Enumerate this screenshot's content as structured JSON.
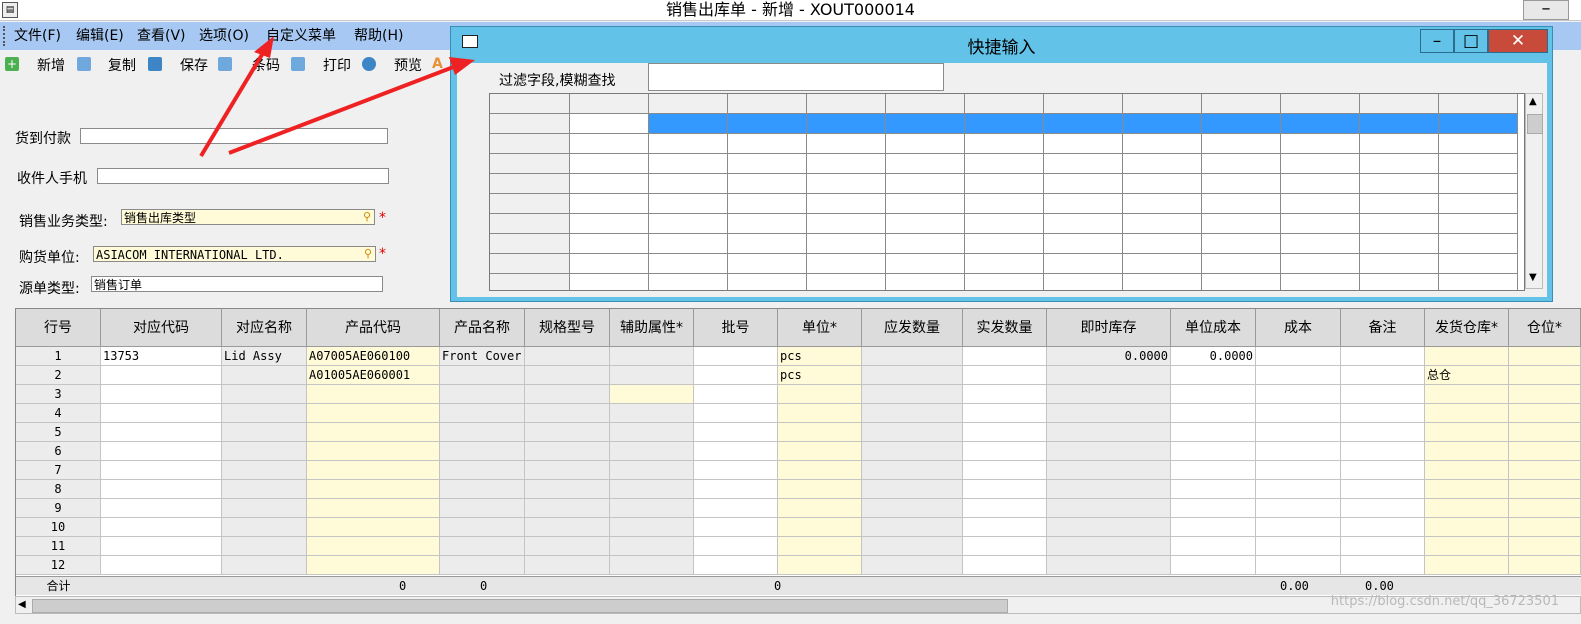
{
  "window": {
    "title": "销售出库单 - 新增 - XOUT000014"
  },
  "menu": {
    "items": [
      "文件(F)",
      "编辑(E)",
      "查看(V)",
      "选项(O)",
      "自定义菜单",
      "帮助(H)"
    ]
  },
  "toolbar": {
    "new": "新增",
    "copy": "复制",
    "save": "保存",
    "barcode": "条码",
    "print": "打印",
    "preview": "预览"
  },
  "form": {
    "cod_label": "货到付款",
    "phone_label": "收件人手机",
    "biztype_label": "销售业务类型:",
    "biztype_value": "销售出库类型",
    "buyer_label": "购货单位:",
    "buyer_value": "ASIACOM INTERNATIONAL LTD.",
    "srctype_label": "源单类型:",
    "srctype_value": "销售订单"
  },
  "popup": {
    "title": "快捷输入",
    "filter_label": "过滤字段,模糊查找",
    "filter_value": ""
  },
  "grid": {
    "headers": [
      "行号",
      "对应代码",
      "对应名称",
      "产品代码",
      "产品名称",
      "规格型号",
      "辅助属性*",
      "批号",
      "单位*",
      "应发数量",
      "实发数量",
      "即时库存",
      "单位成本",
      "成本",
      "备注",
      "发货仓库*",
      "仓位*"
    ],
    "rows": [
      {
        "no": "1",
        "code": "13753",
        "name": "Lid Assy",
        "product_code": "A07005AE060100",
        "product_name": "Front Cover",
        "unit": "pcs",
        "stock": "0.0000",
        "unit_cost": "0.0000",
        "warehouse": ""
      },
      {
        "no": "2",
        "code": "",
        "name": "",
        "product_code": "A01005AE060001",
        "product_name": "",
        "unit": "pcs",
        "stock": "",
        "unit_cost": "",
        "warehouse": "总仓"
      },
      {
        "no": "3"
      },
      {
        "no": "4"
      },
      {
        "no": "5"
      },
      {
        "no": "6"
      },
      {
        "no": "7"
      },
      {
        "no": "8"
      },
      {
        "no": "9"
      },
      {
        "no": "10"
      },
      {
        "no": "11"
      },
      {
        "no": "12"
      }
    ],
    "total_label": "合计",
    "totals": {
      "product_code": "0",
      "product_name": "0",
      "batch": "0",
      "cost": "0.00",
      "remark": "0.00"
    }
  },
  "watermark": "https://blog.csdn.net/qq_36723501",
  "colors": {
    "menubar": "#a6c8f2",
    "popup": "#62c2e8",
    "selected_row": "#3399ff",
    "required": "#fffbd8",
    "arrow": "#ee2222"
  }
}
